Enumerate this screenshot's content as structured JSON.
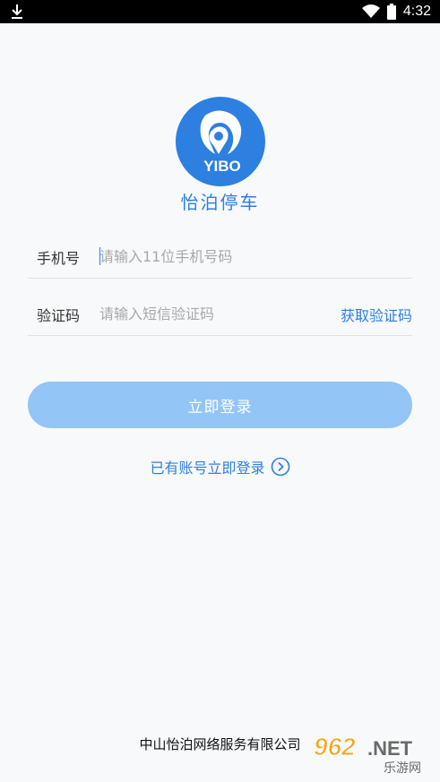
{
  "status_bar": {
    "time": "4:32",
    "download_icon": "download-icon",
    "wifi_icon": "wifi-icon",
    "battery_icon": "battery-icon"
  },
  "logo": {
    "brand_text": "YIBO",
    "icon": "logo-location-icon"
  },
  "app_name": "怡泊停车",
  "form": {
    "phone": {
      "label": "手机号",
      "placeholder": "请输入11位手机号码",
      "value": ""
    },
    "code": {
      "label": "验证码",
      "placeholder": "请输入短信验证码",
      "value": "",
      "get_code_label": "获取验证码"
    },
    "login_button": "立即登录"
  },
  "account_link": {
    "label": "已有账号立即登录",
    "icon": "chevron-right-circle-icon"
  },
  "footer": {
    "company": "中山怡泊网络服务有限公司"
  },
  "watermark": {
    "text": "962.NET",
    "subtext": "乐游网"
  },
  "colors": {
    "accent": "#2d7fe0",
    "button_disabled": "#93c5f6",
    "background": "#f8f9fb"
  }
}
